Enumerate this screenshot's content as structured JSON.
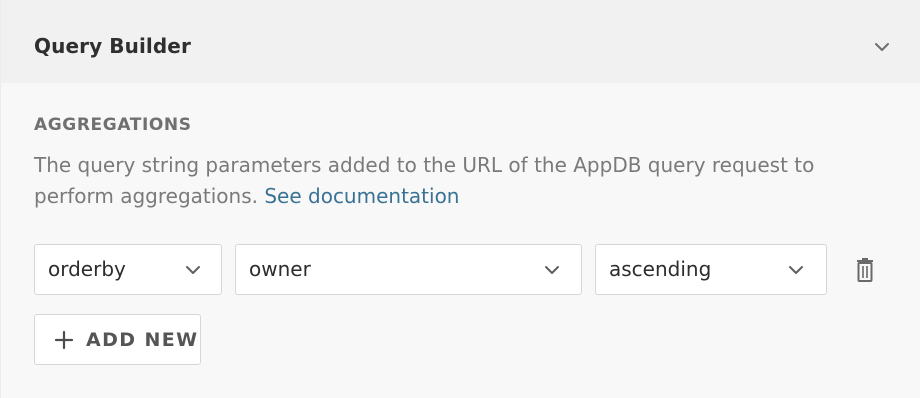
{
  "colors": {
    "header_bg": "#f1f1f1",
    "panel_bg": "#f8f8f8",
    "link": "#3a7294",
    "muted_text": "#7a7a7a",
    "heading_text": "#707070",
    "border": "#d6d6d6"
  },
  "panel": {
    "title": "Query Builder",
    "collapse_icon": "chevron-down-icon"
  },
  "aggregations": {
    "heading": "AGGREGATIONS",
    "description": "The query string parameters added to the URL of the AppDB query request to perform aggregations. ",
    "link_text": "See documentation",
    "rows": [
      {
        "aggregation": "orderby",
        "field": "owner",
        "direction": "ascending",
        "delete_icon": "trash-icon"
      }
    ],
    "add_button": {
      "icon": "plus-icon",
      "label": "ADD NEW"
    }
  }
}
